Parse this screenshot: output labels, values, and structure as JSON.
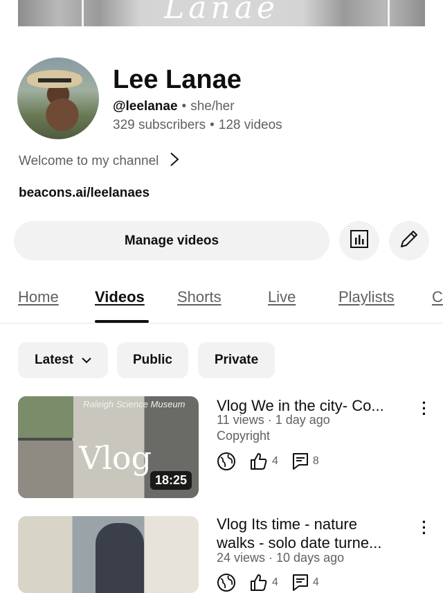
{
  "banner": {
    "script_text": "Lanae"
  },
  "channel": {
    "name": "Lee Lanae",
    "handle": "@leelanae",
    "pronouns": "she/her",
    "subscribers": "329 subscribers",
    "videos": "128 videos",
    "welcome": "Welcome to my channel",
    "link": "beacons.ai/leelanaes"
  },
  "actions": {
    "manage_label": "Manage videos"
  },
  "tabs": [
    {
      "label": "Home",
      "active": false
    },
    {
      "label": "Videos",
      "active": true
    },
    {
      "label": "Shorts",
      "active": false
    },
    {
      "label": "Live",
      "active": false
    },
    {
      "label": "Playlists",
      "active": false
    },
    {
      "label": "C",
      "active": false
    }
  ],
  "filters": [
    {
      "label": "Latest",
      "dropdown": true
    },
    {
      "label": "Public"
    },
    {
      "label": "Private"
    }
  ],
  "videos": [
    {
      "title": "Vlog We in the city- Co...",
      "views_age": "11 views · 1 day ago",
      "extra": "Copyright",
      "duration": "18:25",
      "thumb_text": "Vlog",
      "thumb_caption": "Raleigh Science Museum",
      "likes": "4",
      "comments": "8",
      "visibility_icon": "globe-icon"
    },
    {
      "title_line1": "Vlog Its time - nature",
      "title_line2": "walks - solo date turne...",
      "views_age": "24 views · 10 days ago",
      "likes": "4",
      "comments": "4",
      "visibility_icon": "globe-icon"
    }
  ],
  "colors": {
    "text_primary": "#0f0f0f",
    "text_secondary": "#606060",
    "chip_bg": "#f2f2f2",
    "divider": "#e5e5e5"
  }
}
